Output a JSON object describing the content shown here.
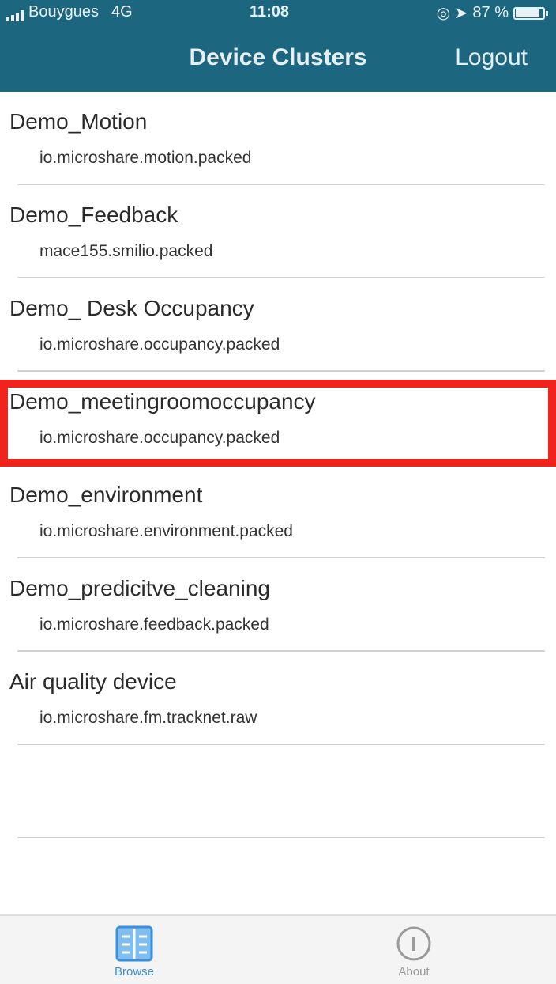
{
  "status_bar": {
    "carrier": "Bouygues",
    "network": "4G",
    "time": "11:08",
    "battery": "87 %",
    "battery_level": 0.87
  },
  "nav": {
    "title": "Device Clusters",
    "logout_label": "Logout"
  },
  "clusters": [
    {
      "name": "Demo_Motion",
      "recType": "io.microshare.motion.packed"
    },
    {
      "name": "Demo_Feedback",
      "recType": "mace155.smilio.packed"
    },
    {
      "name": "Demo_ Desk Occupancy",
      "recType": "io.microshare.occupancy.packed"
    },
    {
      "name": "Demo_meetingroomoccupancy",
      "recType": "io.microshare.occupancy.packed"
    },
    {
      "name": "Demo_environment",
      "recType": "io.microshare.environment.packed"
    },
    {
      "name": "Demo_predicitve_cleaning",
      "recType": "io.microshare.feedback.packed"
    },
    {
      "name": "Air quality device",
      "recType": "io.microshare.fm.tracknet.raw"
    }
  ],
  "highlighted_index": 3,
  "tabs": {
    "browse_label": "Browse",
    "about_label": "About"
  },
  "colors": {
    "header": "#1d6680",
    "highlight": "#f0241c",
    "active_tab": "#3a8fd8"
  }
}
